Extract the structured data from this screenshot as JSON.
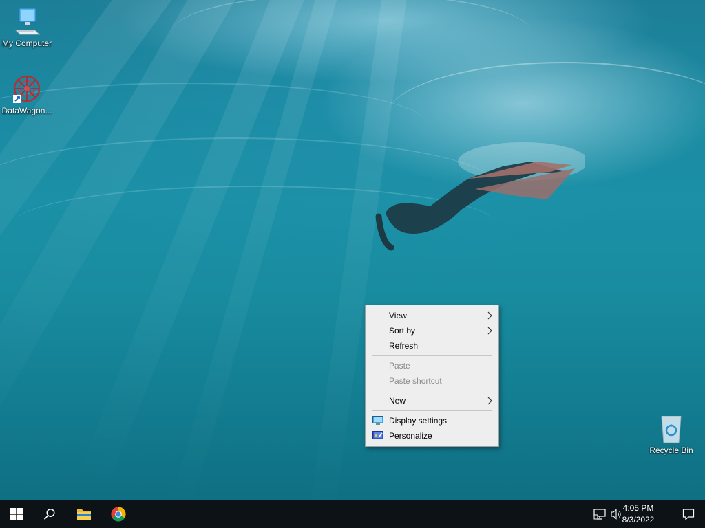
{
  "desktop": {
    "icons": [
      {
        "label": "My Computer",
        "icon": "computer-icon"
      },
      {
        "label": "DataWagon...",
        "icon": "datawagon-icon"
      },
      {
        "label": "Recycle Bin",
        "icon": "recycle-bin-icon"
      }
    ]
  },
  "context_menu": {
    "items": [
      {
        "label": "View",
        "has_submenu": true,
        "enabled": true
      },
      {
        "label": "Sort by",
        "has_submenu": true,
        "enabled": true
      },
      {
        "label": "Refresh",
        "enabled": true
      },
      {
        "label": "Paste",
        "enabled": false
      },
      {
        "label": "Paste shortcut",
        "enabled": false
      },
      {
        "label": "New",
        "has_submenu": true,
        "enabled": true
      },
      {
        "label": "Display settings",
        "icon": "display-icon",
        "enabled": true
      },
      {
        "label": "Personalize",
        "icon": "personalize-icon",
        "enabled": true
      }
    ]
  },
  "taskbar": {
    "buttons": [
      {
        "name": "start",
        "icon": "windows-logo-icon"
      },
      {
        "name": "search",
        "icon": "search-icon"
      },
      {
        "name": "file-explorer",
        "icon": "folder-icon"
      },
      {
        "name": "chrome",
        "icon": "chrome-icon"
      }
    ],
    "tray": {
      "time": "4:05 PM",
      "date": "8/3/2022",
      "icons": [
        "network-icon",
        "volume-icon",
        "notifications-icon"
      ]
    }
  },
  "colors": {
    "taskbar": "#0d1216",
    "menu_background": "#eeeeee",
    "disabled_text": "#8a8a8a"
  }
}
